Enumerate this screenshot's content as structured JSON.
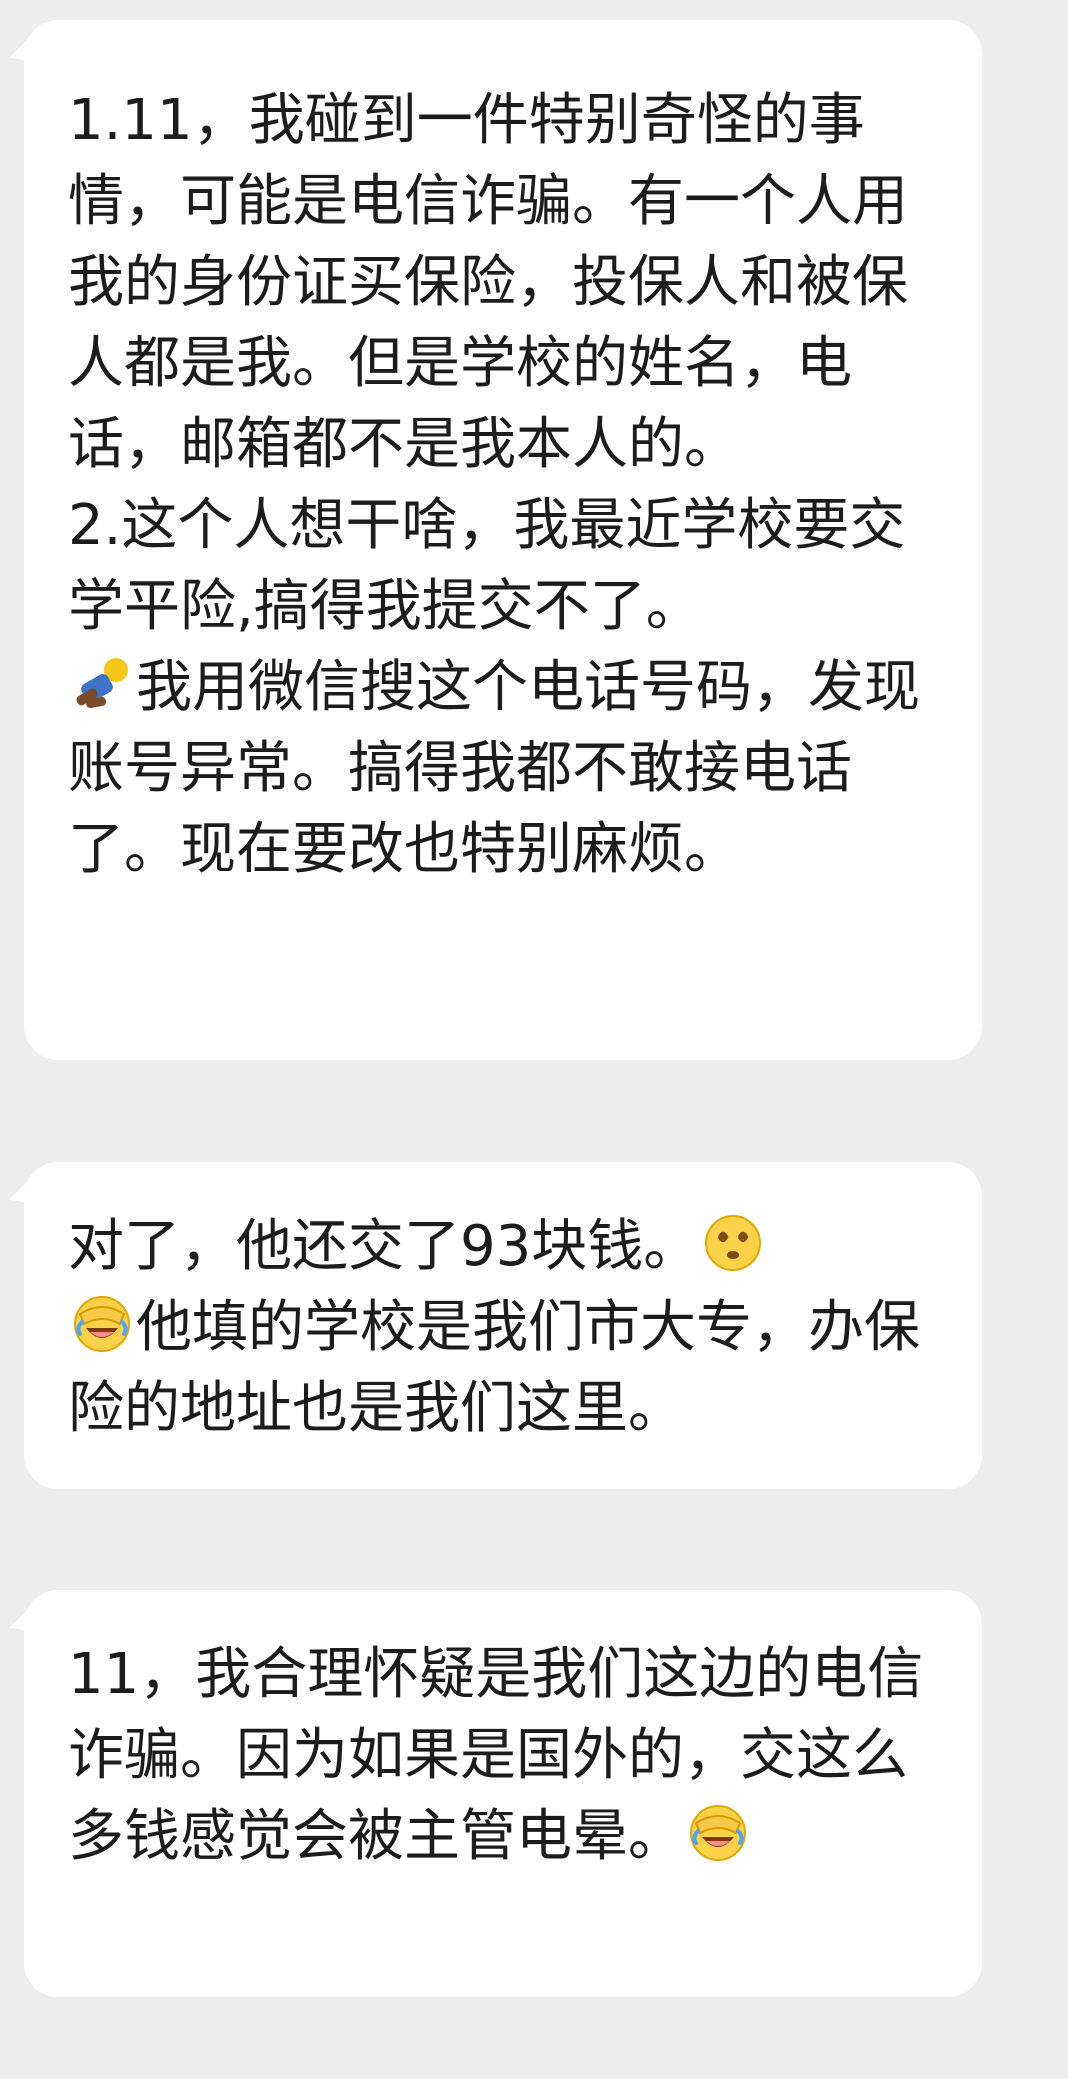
{
  "messages": [
    {
      "id": "msg-1",
      "paragraphs": [
        "1.11，我碰到一件特别奇怪的事情，可能是电信诈骗。有一个人用我的身份证买保险，投保人和被保人都是我。但是学校的姓名，电话，邮箱都不是我本人的。",
        "2.这个人想干啥，我最近学校要交学平险,搞得我提交不了。"
      ],
      "emoji_line": {
        "icon": "emoji-lying-down-icon",
        "text": "我用微信搜这个电话号码，发现账号异常。搞得我都不敢接电话了。现在要改也特别麻烦。"
      }
    },
    {
      "id": "msg-2",
      "line1_text": "对了，他还交了93块钱。",
      "line1_icon": "emoji-dizzy-face-icon",
      "line2_icon": "emoji-facepalm-laugh-icon",
      "line2_text": "他填的学校是我们市大专，办保险的地址也是我们这里。"
    },
    {
      "id": "msg-3",
      "text": "11，我合理怀疑是我们这边的电信诈骗。因为如果是国外的，交这么多钱感觉会被主管电晕。",
      "end_icon": "emoji-facepalm-laugh-icon"
    }
  ],
  "colors": {
    "background": "#ededed",
    "bubble": "#ffffff",
    "text": "#1c1c1c"
  }
}
